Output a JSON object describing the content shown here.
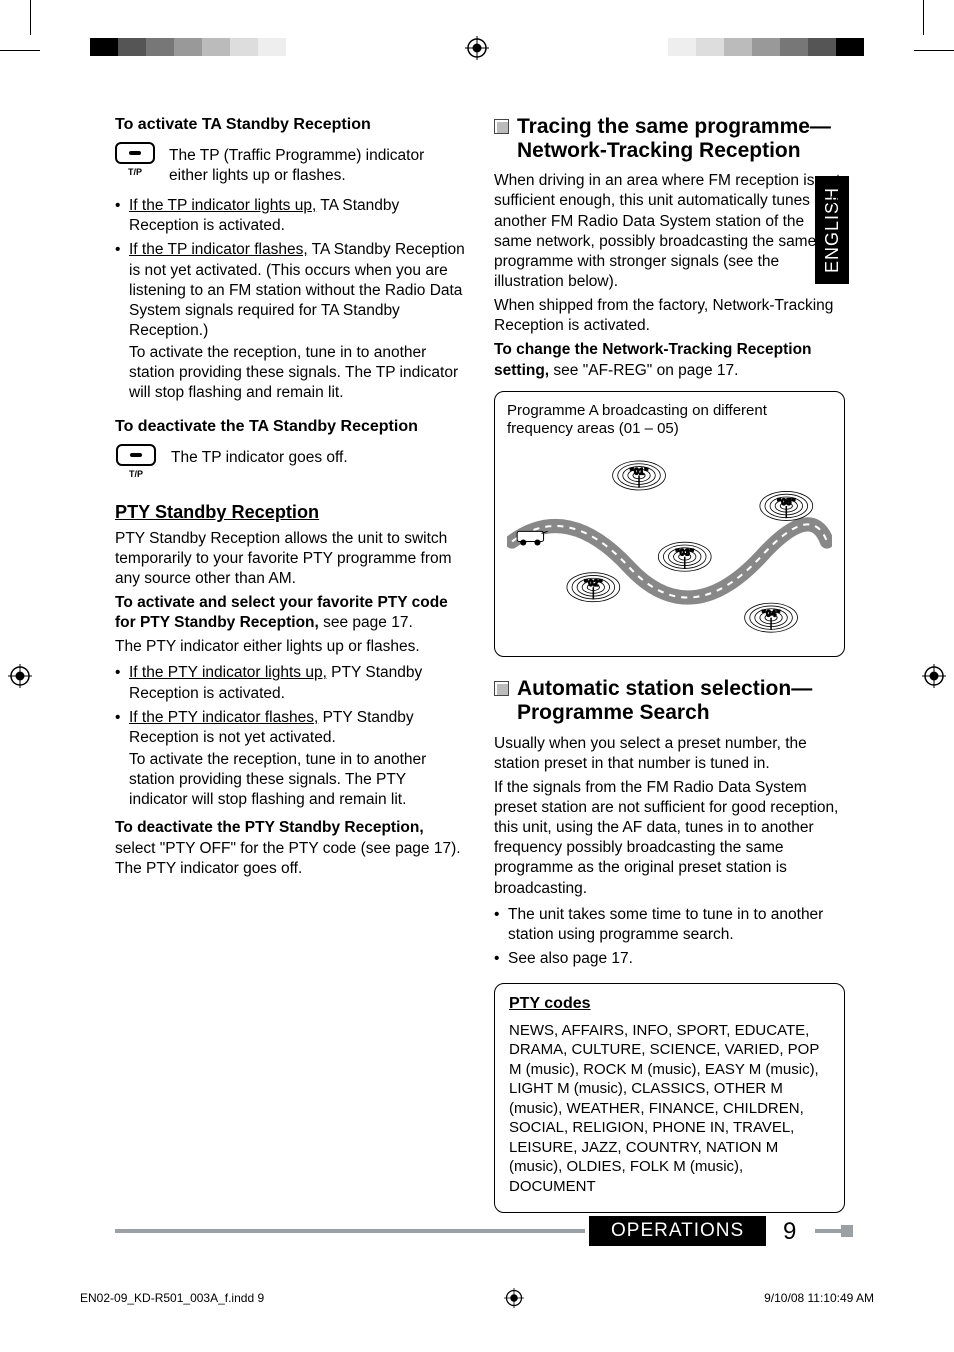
{
  "lang_tab": "ENGLISH",
  "left": {
    "h_activate_ta": "To activate TA Standby Reception",
    "tp_label": "T/P",
    "tp_intro": "The TP (Traffic Programme) indicator either lights up or flashes.",
    "ta_li1_u": "If the TP indicator lights up,",
    "ta_li1_rest": " TA Standby Reception is activated.",
    "ta_li2_u": "If the TP indicator flashes,",
    "ta_li2_rest": " TA Standby Reception is not yet activated. (This occurs when you are listening to an FM station without the Radio Data System signals required for TA Standby Reception.)",
    "ta_li2_cont": "To activate the reception, tune in to another station providing these signals. The TP indicator will stop flashing and remain lit.",
    "h_deactivate_ta": "To deactivate the TA Standby Reception",
    "tp_goes_off": "The TP indicator goes off.",
    "h_pty_standby": "PTY Standby Reception",
    "pty_standby_p": "PTY Standby Reception allows the unit to switch temporarily to your favorite PTY programme from any source other than AM.",
    "h_activate_pty_b": "To activate and select your favorite PTY code for PTY Standby Reception,",
    "h_activate_pty_rest": " see page 17.",
    "pty_lights_p": "The PTY indicator either lights up or flashes.",
    "pty_li1_u": "If the PTY indicator lights up,",
    "pty_li1_rest": " PTY Standby Reception is activated.",
    "pty_li2_u": "If the PTY indicator flashes,",
    "pty_li2_rest": " PTY Standby Reception is not yet activated.",
    "pty_li2_cont": "To activate the reception, tune in to another station providing these signals. The PTY indicator will stop flashing and remain lit.",
    "h_deactivate_pty_b": "To deactivate the PTY Standby Reception,",
    "h_deactivate_pty_rest": " select \"PTY OFF\" for the PTY code (see page 17). The PTY indicator goes off."
  },
  "right": {
    "sec1_title": "Tracing the same programme—Network-Tracking Reception",
    "sec1_p1": "When driving in an area where FM reception is not sufficient enough, this unit automatically tunes in to another FM Radio Data System station of the same network, possibly broadcasting the same programme with stronger signals (see the illustration below).",
    "sec1_p2": "When shipped from the factory, Network-Tracking Reception is activated.",
    "sec1_change_b": "To change the Network-Tracking Reception setting,",
    "sec1_change_rest": " see \"AF-REG\" on page 17.",
    "fig_caption": "Programme A broadcasting on different frequency areas (01 – 05)",
    "sec2_title": "Automatic station selection—Programme Search",
    "sec2_p1": "Usually when you select a preset number, the station preset in that number is tuned in.",
    "sec2_p2": "If the signals from the FM Radio Data System preset station are not sufficient for good reception, this unit, using the AF data, tunes in to another frequency possibly broadcasting the same programme as the original preset station is broadcasting.",
    "sec2_li1": "The unit takes some time to tune in to another station using programme search.",
    "sec2_li2": "See also page 17.",
    "ptycodes_h": "PTY codes",
    "ptycodes_body": "NEWS, AFFAIRS, INFO, SPORT, EDUCATE, DRAMA, CULTURE, SCIENCE, VARIED, POP M (music), ROCK M (music), EASY M (music), LIGHT M (music), CLASSICS, OTHER M (music), WEATHER, FINANCE, CHILDREN, SOCIAL, RELIGION, PHONE IN, TRAVEL, LEISURE, JAZZ, COUNTRY, NATION M (music), OLDIES, FOLK M (music), DOCUMENT"
  },
  "bottom": {
    "section": "OPERATIONS",
    "page_no": "9"
  },
  "footer": {
    "file": "EN02-09_KD-R501_003A_f.indd   9",
    "ts": "9/10/08   11:10:49 AM"
  },
  "fig": {
    "nodes": [
      "01",
      "02",
      "03",
      "04",
      "05"
    ]
  }
}
